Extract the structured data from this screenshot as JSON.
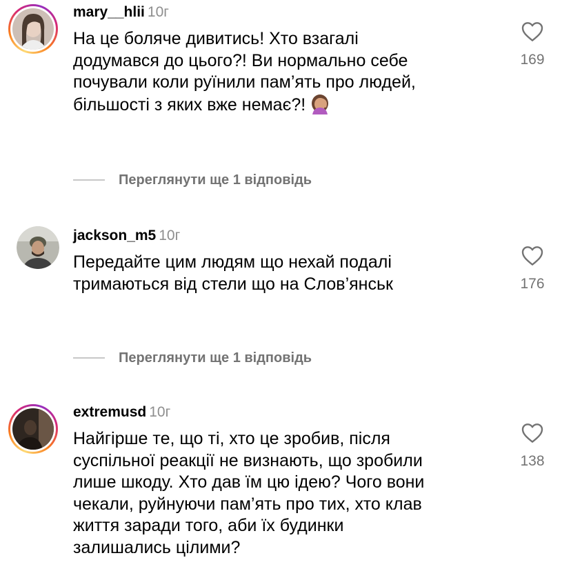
{
  "comments": [
    {
      "username": "mary__hlii",
      "time": "10г",
      "text_lines": [
        "На це боляче дивитись! Хто взагалі",
        "додумався до цього?! Ви нормально себе",
        "почували коли руїнили пам’ять про людей,",
        "більшості з яких вже немає?!"
      ],
      "emoji": "facepalm-emoji",
      "likes": "169",
      "has_story": true
    },
    {
      "username": "jackson_m5",
      "time": "10г",
      "text_lines": [
        "Передайте цим людям що нехай подалі",
        "тримаються від стели що на Слов’янськ"
      ],
      "likes": "176",
      "has_story": false
    },
    {
      "username": "extremusd",
      "time": "10г",
      "text_lines": [
        "Найгірше те, що ті, хто це зробив, після",
        "суспільної реакції не визнають, що зробили",
        "лише шкоду. Хто дав їм цю ідею? Чого вони",
        "чекали, руйнуючи пам’ять про тих, хто клав",
        "життя заради того, аби їх будинки",
        "залишались цілими?"
      ],
      "likes": "138",
      "has_story": true
    }
  ],
  "view_replies": [
    {
      "label": "Переглянути ще 1 відповідь"
    },
    {
      "label": "Переглянути ще 1 відповідь"
    }
  ],
  "icons": {
    "like": "heart-outline-icon"
  },
  "colors": {
    "secondary_text": "#8e8e8e",
    "like_count": "#737373",
    "divider": "#c7c7c7",
    "story_ring": [
      "#feda75",
      "#fa7e1e",
      "#d62976",
      "#962fbf"
    ]
  }
}
